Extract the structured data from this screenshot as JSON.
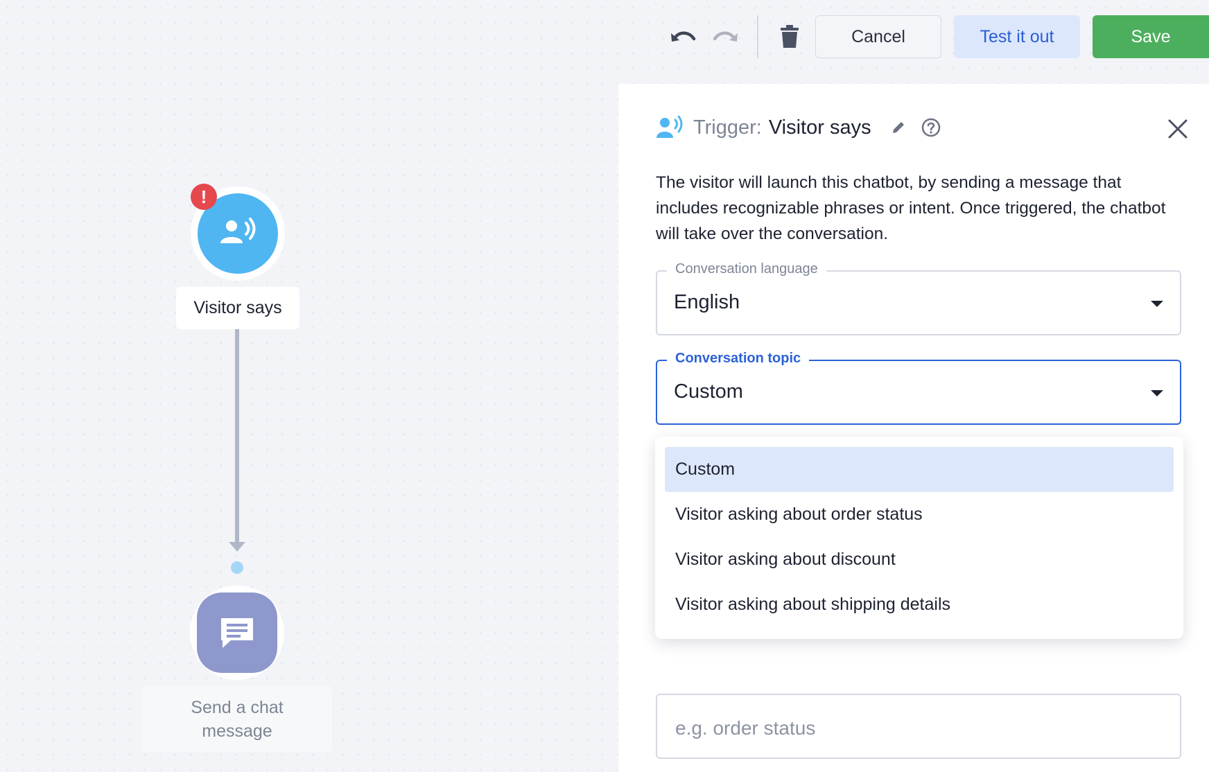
{
  "toolbar": {
    "undo_icon": "undo-icon",
    "redo_icon": "redo-icon",
    "delete_icon": "trash-icon",
    "cancel_label": "Cancel",
    "test_label": "Test it out",
    "save_label": "Save"
  },
  "canvas": {
    "trigger_node": {
      "label": "Visitor says",
      "icon": "visitor-voice-icon",
      "error_badge": "!",
      "color": "#4fb6f2"
    },
    "action_node": {
      "label": "Send a chat message",
      "icon": "chat-message-icon",
      "color": "#8e98cc"
    }
  },
  "panel": {
    "header_icon": "visitor-voice-icon",
    "trigger_prefix": "Trigger:",
    "trigger_name": "Visitor says",
    "description": "The visitor will launch this chatbot, by sending a message that includes recognizable phrases or intent. Once triggered, the chatbot will take over the conversation.",
    "language_field": {
      "label": "Conversation language",
      "value": "English"
    },
    "topic_field": {
      "label": "Conversation topic",
      "value": "Custom"
    },
    "topic_options": [
      "Custom",
      "Visitor asking about order status",
      "Visitor asking about discount",
      "Visitor asking about shipping details"
    ],
    "selected_option_index": 0,
    "phrase_field": {
      "placeholder": "e.g. order status"
    }
  },
  "colors": {
    "primary_blue": "#2c62d8",
    "save_green": "#4caf5e",
    "error_red": "#e5484d"
  }
}
